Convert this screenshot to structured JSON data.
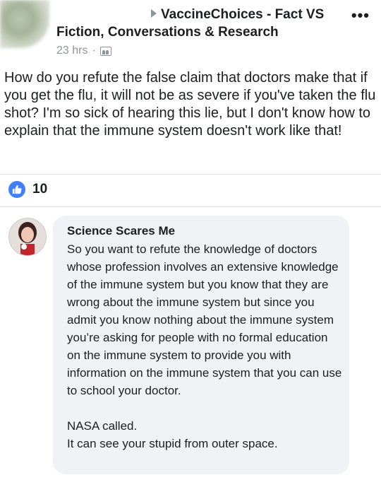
{
  "post": {
    "group_name": "VaccineChoices - Fact VS Fiction, Conversations & Research",
    "time": "23 hrs",
    "separator": "·",
    "more_icon": "more-horizontal-icon",
    "privacy_icon": "group-icon",
    "text": "How do you refute the false claim that doctors make that if you get the flu, it will not be as severe if you've taken the flu shot? I'm so sick of hearing this lie, but I don't know how to explain that the immune system doesn't work like that!"
  },
  "reactions": {
    "icon": "like-icon",
    "count": "10",
    "color": "#4080ff"
  },
  "comment": {
    "author": "Science Scares Me",
    "text": "So you want to refute the knowledge of doctors whose profession involves an extensive knowledge of the immune system but you know that they are wrong about the immune system but since you admit you know nothing about the immune system you’re asking for people with no formal education on the immune system to provide you with information on the immune system that you can use to school your doctor.\n\nNASA called.\nIt can see your stupid from outer space."
  }
}
